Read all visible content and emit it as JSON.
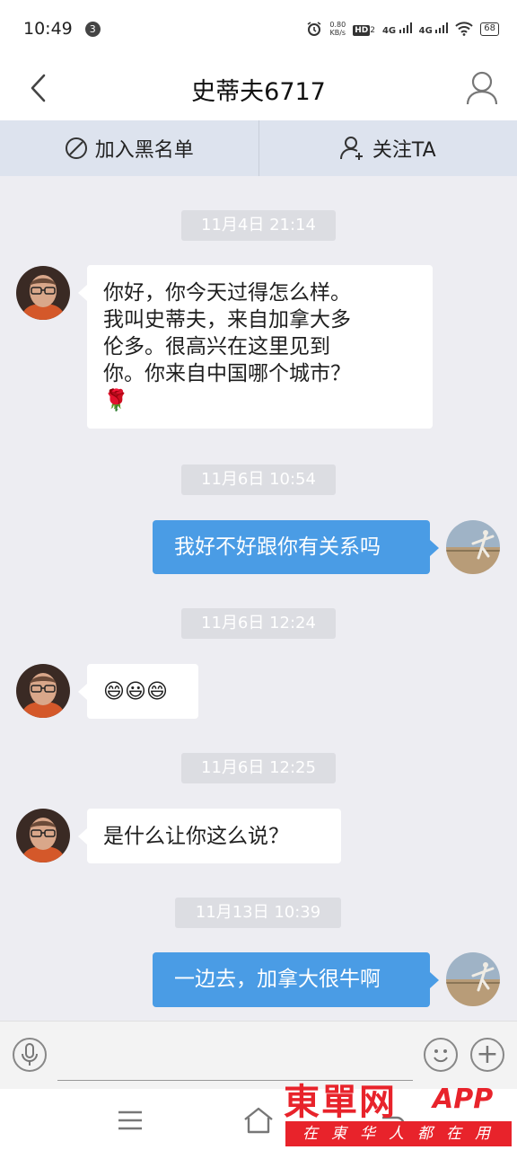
{
  "status_bar": {
    "time": "10:49",
    "notification_count": "3",
    "net_speed_value": "0.80",
    "net_speed_unit": "KB/s",
    "hd_label": "HD",
    "hd_sub": "2",
    "signal1": "4G",
    "signal2": "4G",
    "battery": "68"
  },
  "header": {
    "title": "史蒂夫6717",
    "back_icon": "chevron-left-icon",
    "profile_icon": "user-icon"
  },
  "actions": {
    "blacklist_label": "加入黑名单",
    "blacklist_icon": "block-icon",
    "follow_label": "关注TA",
    "follow_icon": "add-user-icon"
  },
  "messages": [
    {
      "type": "timestamp",
      "text": "11月4日 21:14"
    },
    {
      "type": "incoming",
      "lines": [
        "你好，你今天过得怎么样。",
        "我叫史蒂夫，来自加拿大多",
        "伦多。很高兴在这里见到",
        "你。你来自中国哪个城市？"
      ],
      "emoji": "🌹"
    },
    {
      "type": "timestamp",
      "text": "11月6日 10:54"
    },
    {
      "type": "outgoing",
      "text": "我好不好跟你有关系吗"
    },
    {
      "type": "timestamp",
      "text": "11月6日 12:24"
    },
    {
      "type": "incoming",
      "text": "😄😃😄"
    },
    {
      "type": "timestamp",
      "text": "11月6日 12:25"
    },
    {
      "type": "incoming",
      "text": "是什么让你这么说？"
    },
    {
      "type": "timestamp",
      "text": "11月13日 10:39"
    },
    {
      "type": "outgoing",
      "text": "一边去，加拿大很牛啊"
    }
  ],
  "input_bar": {
    "voice_icon": "microphone-icon",
    "emoji_icon": "smiley-icon",
    "plus_icon": "plus-icon",
    "plus_glyph": "+"
  },
  "system_nav": {
    "menu_icon": "menu-icon",
    "home_icon": "home-icon",
    "back_icon": "back-icon"
  },
  "watermark": {
    "main": "東單网",
    "app": "APP",
    "sub": "在東华人都在用"
  },
  "colors": {
    "outgoing_bubble": "#4a9ce5",
    "incoming_bubble": "#ffffff",
    "chat_background": "#ededf2",
    "action_bar": "#dde3ee",
    "watermark_red": "#e8232b"
  }
}
